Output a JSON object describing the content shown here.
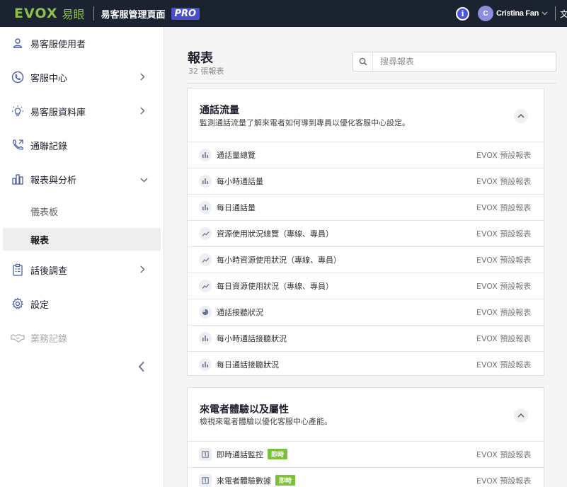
{
  "topbar": {
    "logo_text": "EVOX",
    "logo_cn": "易眼",
    "app_title": "易客服管理頁面",
    "pro_label": "PRO",
    "info_glyph": "i",
    "avatar_initial": "C",
    "user_name": "Cristina Fan",
    "lang_glyph": "文",
    "brand_color": "#8fbf4a",
    "pro_color": "#4a4fd0"
  },
  "sidebar": {
    "items": [
      {
        "label": "易客服使用者",
        "icon": "user-icon"
      },
      {
        "label": "客服中心",
        "icon": "headset-icon"
      },
      {
        "label": "易客服資料庫",
        "icon": "lightbulb-icon"
      },
      {
        "label": "通聯記錄",
        "icon": "phone-icon"
      },
      {
        "label": "報表與分析",
        "icon": "bar-chart-icon"
      },
      {
        "label": "話後調查",
        "icon": "clipboard-icon"
      },
      {
        "label": "設定",
        "icon": "gear-icon"
      },
      {
        "label": "業務記錄",
        "icon": "handshake-icon"
      }
    ],
    "sub_items": [
      {
        "label": "儀表板"
      },
      {
        "label": "報表"
      }
    ]
  },
  "main": {
    "title": "報表",
    "count": "32 張報表",
    "search_placeholder": "搜尋報表"
  },
  "sections": [
    {
      "title": "通話流量",
      "description": "監測通話流量了解來電者如何導到專員以優化客服中心設定。",
      "rows": [
        {
          "label": "通話量總覽",
          "tag": "EVOX 預設報表",
          "icon": "bar-chart-icon"
        },
        {
          "label": "每小時通話量",
          "tag": "EVOX 預設報表",
          "icon": "bar-chart-icon"
        },
        {
          "label": "每日通話量",
          "tag": "EVOX 預設報表",
          "icon": "bar-chart-icon"
        },
        {
          "label": "資源使用狀況總覽（專線、專員）",
          "tag": "EVOX 預設報表",
          "icon": "line-chart-icon"
        },
        {
          "label": "每小時資源使用狀況（專線、專員）",
          "tag": "EVOX 預設報表",
          "icon": "line-chart-icon"
        },
        {
          "label": "每日資源使用狀況（專線、專員）",
          "tag": "EVOX 預設報表",
          "icon": "line-chart-icon"
        },
        {
          "label": "通話接聽狀況",
          "tag": "EVOX 預設報表",
          "icon": "pie-chart-icon"
        },
        {
          "label": "每小時通話接聽狀況",
          "tag": "EVOX 預設報表",
          "icon": "bar-chart-icon"
        },
        {
          "label": "每日通話接聽狀況",
          "tag": "EVOX 預設報表",
          "icon": "bar-chart-icon"
        }
      ]
    },
    {
      "title": "來電者體驗以及屬性",
      "description": "檢視來電者體驗以優化客服中心產能。",
      "rows": [
        {
          "label": "即時通話監控",
          "badge": "即時",
          "tag": "EVOX 預設報表",
          "icon": "number-icon"
        },
        {
          "label": "來電者體驗數據",
          "badge": "即時",
          "tag": "EVOX 預設報表",
          "icon": "number-icon"
        }
      ]
    }
  ]
}
